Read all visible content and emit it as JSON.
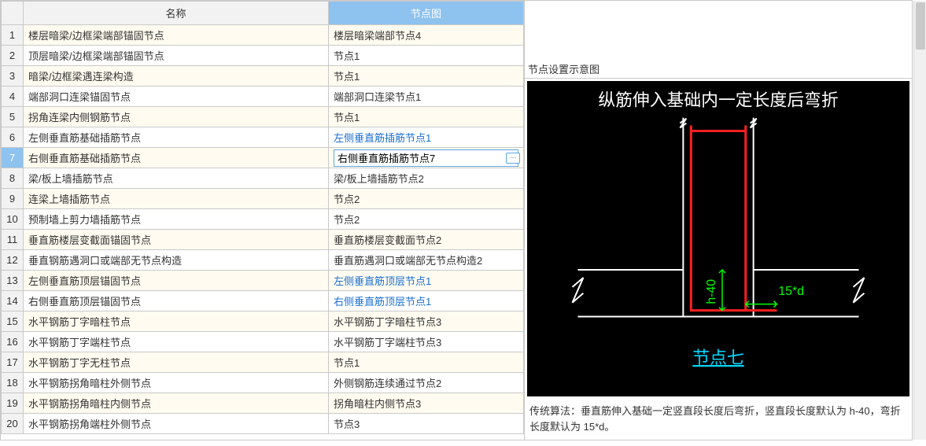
{
  "headers": {
    "name": "名称",
    "node": "节点图"
  },
  "rows": [
    {
      "num": "1",
      "name": "楼层暗梁/边框梁端部锚固节点",
      "node": "楼层暗梁端部节点4",
      "link": false
    },
    {
      "num": "2",
      "name": "顶层暗梁/边框梁端部锚固节点",
      "node": "节点1",
      "link": false
    },
    {
      "num": "3",
      "name": "暗梁/边框梁遇连梁构造",
      "node": "节点1",
      "link": false
    },
    {
      "num": "4",
      "name": "端部洞口连梁锚固节点",
      "node": "端部洞口连梁节点1",
      "link": false
    },
    {
      "num": "5",
      "name": "拐角连梁内侧钢筋节点",
      "node": "节点1",
      "link": false
    },
    {
      "num": "6",
      "name": "左侧垂直筋基础插筋节点",
      "node": "左侧垂直筋插筋节点1",
      "link": true
    },
    {
      "num": "7",
      "name": "右侧垂直筋基础插筋节点",
      "node": "右侧垂直筋插筋节点7",
      "link": false,
      "selected": true
    },
    {
      "num": "8",
      "name": "梁/板上墙插筋节点",
      "node": "梁/板上墙插筋节点2",
      "link": false
    },
    {
      "num": "9",
      "name": "连梁上墙插筋节点",
      "node": "节点2",
      "link": false
    },
    {
      "num": "10",
      "name": "预制墙上剪力墙插筋节点",
      "node": "节点2",
      "link": false
    },
    {
      "num": "11",
      "name": "垂直筋楼层变截面锚固节点",
      "node": "垂直筋楼层变截面节点2",
      "link": false
    },
    {
      "num": "12",
      "name": "垂直钢筋遇洞口或端部无节点构造",
      "node": "垂直筋遇洞口或端部无节点构造2",
      "link": false
    },
    {
      "num": "13",
      "name": "左侧垂直筋顶层锚固节点",
      "node": "左侧垂直筋顶层节点1",
      "link": true
    },
    {
      "num": "14",
      "name": "右侧垂直筋顶层锚固节点",
      "node": "右侧垂直筋顶层节点1",
      "link": true
    },
    {
      "num": "15",
      "name": "水平钢筋丁字暗柱节点",
      "node": "水平钢筋丁字暗柱节点3",
      "link": false
    },
    {
      "num": "16",
      "name": "水平钢筋丁字端柱节点",
      "node": "水平钢筋丁字端柱节点3",
      "link": false
    },
    {
      "num": "17",
      "name": "水平钢筋丁字无柱节点",
      "node": "节点1",
      "link": false
    },
    {
      "num": "18",
      "name": "水平钢筋拐角暗柱外侧节点",
      "node": "外侧钢筋连续通过节点2",
      "link": false
    },
    {
      "num": "19",
      "name": "水平钢筋拐角暗柱内侧节点",
      "node": "拐角暗柱内侧节点3",
      "link": false
    },
    {
      "num": "20",
      "name": "水平钢筋拐角端柱外侧节点",
      "node": "节点3",
      "link": false
    }
  ],
  "diagram": {
    "panel_title": "节点设置示意图",
    "title": "纵筋伸入基础内一定长度后弯折",
    "label_h40": "h-40",
    "label_15d": "15*d",
    "node_label": "节点七"
  },
  "description": "传统算法：垂直筋伸入基础一定竖直段长度后弯折，竖直段长度默认为 h-40，弯折长度默认为 15*d。",
  "more_btn": "⋯"
}
